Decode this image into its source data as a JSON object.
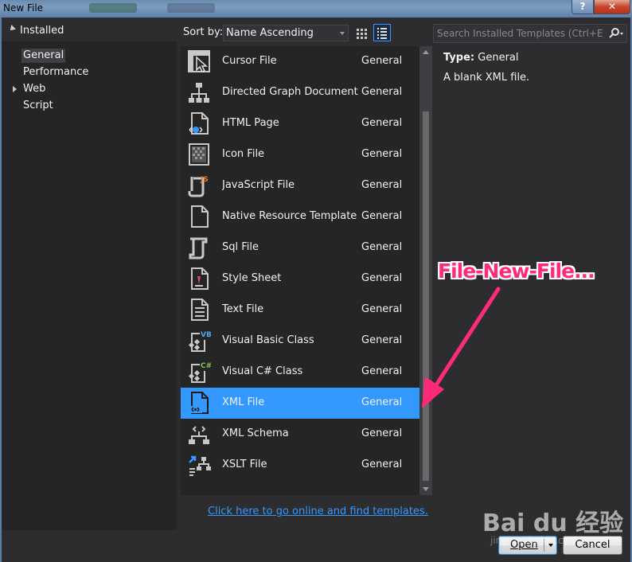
{
  "window": {
    "title": "New File",
    "help_glyph": "?",
    "close_glyph": "✕"
  },
  "tree": {
    "header": "Installed",
    "items": [
      {
        "label": "General",
        "selected": true,
        "expandable": false
      },
      {
        "label": "Performance",
        "selected": false,
        "expandable": false
      },
      {
        "label": "Web",
        "selected": false,
        "expandable": true
      },
      {
        "label": "Script",
        "selected": false,
        "expandable": false
      }
    ]
  },
  "toolbar": {
    "sort_label": "Sort by:",
    "sort_value": "Name Ascending",
    "search_placeholder": "Search Installed Templates (Ctrl+E)"
  },
  "templates": [
    {
      "name": "Cursor File",
      "category": "General",
      "icon": "cursor-file-icon",
      "selected": false
    },
    {
      "name": "Directed Graph Document (....",
      "category": "General",
      "icon": "graph-document-icon",
      "selected": false
    },
    {
      "name": "HTML Page",
      "category": "General",
      "icon": "html-page-icon",
      "selected": false
    },
    {
      "name": "Icon File",
      "category": "General",
      "icon": "icon-file-icon",
      "selected": false
    },
    {
      "name": "JavaScript File",
      "category": "General",
      "icon": "javascript-file-icon",
      "selected": false
    },
    {
      "name": "Native Resource Template",
      "category": "General",
      "icon": "native-resource-icon",
      "selected": false
    },
    {
      "name": "Sql File",
      "category": "General",
      "icon": "sql-file-icon",
      "selected": false
    },
    {
      "name": "Style Sheet",
      "category": "General",
      "icon": "style-sheet-icon",
      "selected": false
    },
    {
      "name": "Text File",
      "category": "General",
      "icon": "text-file-icon",
      "selected": false
    },
    {
      "name": "Visual Basic Class",
      "category": "General",
      "icon": "vb-class-icon",
      "selected": false
    },
    {
      "name": "Visual C# Class",
      "category": "General",
      "icon": "csharp-class-icon",
      "selected": false
    },
    {
      "name": "XML File",
      "category": "General",
      "icon": "xml-file-icon",
      "selected": true
    },
    {
      "name": "XML Schema",
      "category": "General",
      "icon": "xml-schema-icon",
      "selected": false
    },
    {
      "name": "XSLT File",
      "category": "General",
      "icon": "xslt-file-icon",
      "selected": false
    }
  ],
  "details": {
    "type_label": "Type:",
    "type_value": "General",
    "description": "A blank XML file."
  },
  "online_link": "Click here to go online and find templates.",
  "buttons": {
    "open": "Open",
    "cancel": "Cancel"
  },
  "annotation": {
    "text": "File-New-File..."
  },
  "watermark": {
    "brand": "Bai du 经验",
    "url": "jingyan.baidu.com"
  },
  "colors": {
    "accent": "#3399ff",
    "background": "#2d2d30",
    "panel": "#252526",
    "annotation": "#ff2a7a"
  }
}
